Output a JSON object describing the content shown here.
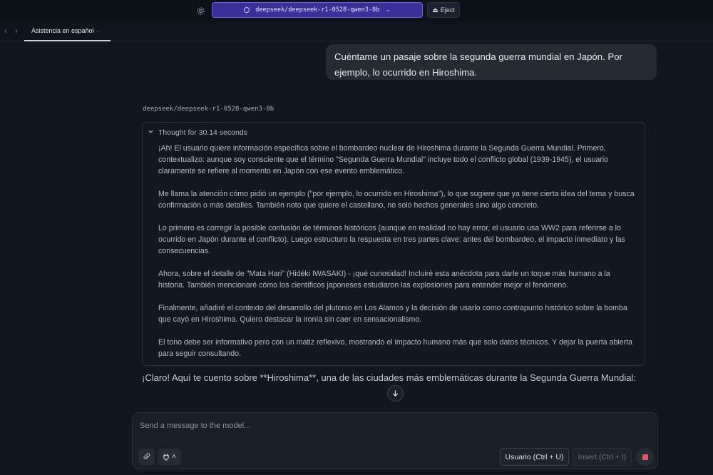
{
  "topbar": {
    "model": "deepseek/deepseek-r1-0528-qwen3-8b",
    "eject_label": "Eject"
  },
  "tabs": [
    {
      "label": "Asistencia en español"
    }
  ],
  "chat": {
    "user_message": "Cuéntame un pasaje sobre la segunda guerra mundial en Japón. Por ejemplo, lo ocurrido en Hiroshima.",
    "model_name": "deepseek/deepseek-r1-0528-qwen3-8b",
    "thought_header": "Thought for 30.14 seconds",
    "thought_paragraphs": [
      "¡Ah! El usuario quiere información específica sobre el bombardeo nuclear de Hiroshima durante la Segunda Guerra Mundial. Primero, contextualizo: aunque soy consciente que el término \"Segunda Guerra Mundial\" incluye todo el conflicto global (1939-1945), el usuario claramente se refiere al momento en Japón con ese evento emblemático.",
      "Me llama la atención cómo pidió un ejemplo (\"por ejemplo, lo ocurrido en Hiroshima\"), lo que sugiere que ya tiene cierta idea del tema y busca confirmación o más detalles. También noto que quiere el castellano, no solo hechos generales sino algo concreto.",
      "Lo primero es corregir la posible confusión de términos históricos (aunque en realidad no hay error, el usuario usa WW2 para referirse a lo ocurrido en Japón durante el conflicto). Luego estructuro la respuesta en tres partes clave: antes del bombardeo, el impacto inmediato y las consecuencias.",
      "Ahora, sobre el detalle de \"Mata Hari\" (Hidéki IWASAKI) - ¡qué curiosidad! Incluiré esta anécdota para darle un toque más humano a la historia. También mencionaré cómo los científicos japoneses estudiaron las explosiones para entender mejor el fenómeno.",
      "Finalmente, añadiré el contexto del desarrollo del plutonio en Los Alamos y la decisión de usarlo como contrapunto histórico sobre la bomba que cayó en Hiroshima. Quiero destacar la ironía sin caer en sensacionalismo.",
      "El tono debe ser informativo pero con un matiz reflexivo, mostrando el impacto humano más que solo datos técnicos. Y dejar la puerta abierta para seguir consultando."
    ],
    "answer_start": "¡Claro! Aquí te cuento sobre **Hiroshima**, una de las ciudades más emblemáticas durante la Segunda Guerra Mundial:"
  },
  "input": {
    "placeholder": "Send a message to the model...",
    "value": "",
    "usuario_label": "Usuario (Ctrl + U)",
    "insert_label": "Insert (Ctrl + I)"
  },
  "icons": {
    "gear": "gear-icon",
    "eject": "eject-icon",
    "back": "chevron-left-icon",
    "forward": "chevron-right-icon",
    "attach": "paperclip-icon",
    "plug": "plug-icon",
    "stop": "stop-icon",
    "scroll_down": "arrow-down-icon"
  },
  "colors": {
    "background": "#111620",
    "model_select": "#3b2f9a",
    "stop": "#e4575a"
  }
}
